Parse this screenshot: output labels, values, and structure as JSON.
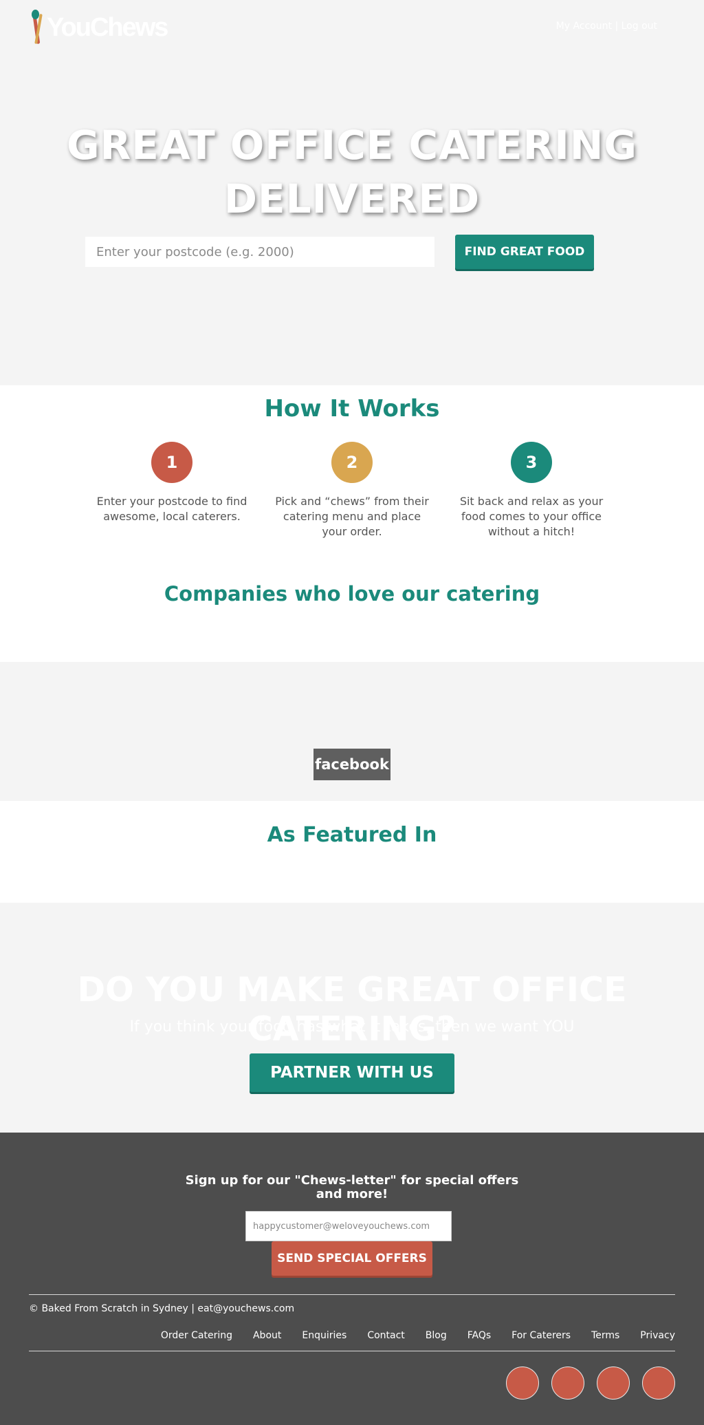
{
  "header": {
    "logo_text": "YouChews",
    "my_account": "My Account",
    "separator": "|",
    "log_out": "Log out"
  },
  "hero": {
    "title_line1": "GREAT OFFICE CATERING",
    "title_line2": "DELIVERED",
    "postcode_placeholder": "Enter your postcode (e.g. 2000)",
    "find_button": "FIND GREAT FOOD"
  },
  "how_it_works": {
    "title": "How It Works",
    "steps": [
      {
        "number": "1",
        "color": "#c75a47",
        "text": "Enter your postcode to find awesome, local caterers."
      },
      {
        "number": "2",
        "color": "#d9a650",
        "text": "Pick and “chews” from their catering menu and place your order."
      },
      {
        "number": "3",
        "color": "#1b8a7b",
        "text": "Sit back and relax as your food comes to your office without a hitch!"
      }
    ]
  },
  "companies": {
    "title": "Companies who love our catering",
    "logo_badge": "facebook"
  },
  "featured": {
    "title": "As Featured In"
  },
  "partner": {
    "title": "DO YOU MAKE GREAT OFFICE CATERING?",
    "subtitle": "If you think your food has what it takes, then we want YOU",
    "button": "PARTNER WITH US"
  },
  "footer": {
    "newsletter_title": "Sign up for our \"Chews-letter\" for special offers and more!",
    "email_placeholder": "happycustomer@weloveyouchews.com",
    "send_button": "SEND SPECIAL OFFERS",
    "copyright": "© Baked From Scratch in Sydney | eat@youchews.com",
    "nav": [
      "Order Catering",
      "About",
      "Enquiries",
      "Contact",
      "Blog",
      "FAQs",
      "For Caterers",
      "Terms",
      "Privacy"
    ],
    "social_icons": [
      "social-icon-1",
      "social-icon-2",
      "social-icon-3",
      "social-icon-4"
    ]
  },
  "colors": {
    "brand_teal": "#1b8a7b",
    "brand_red": "#c75a47",
    "brand_gold": "#d9a650",
    "footer_bg": "#4d4d4d"
  }
}
